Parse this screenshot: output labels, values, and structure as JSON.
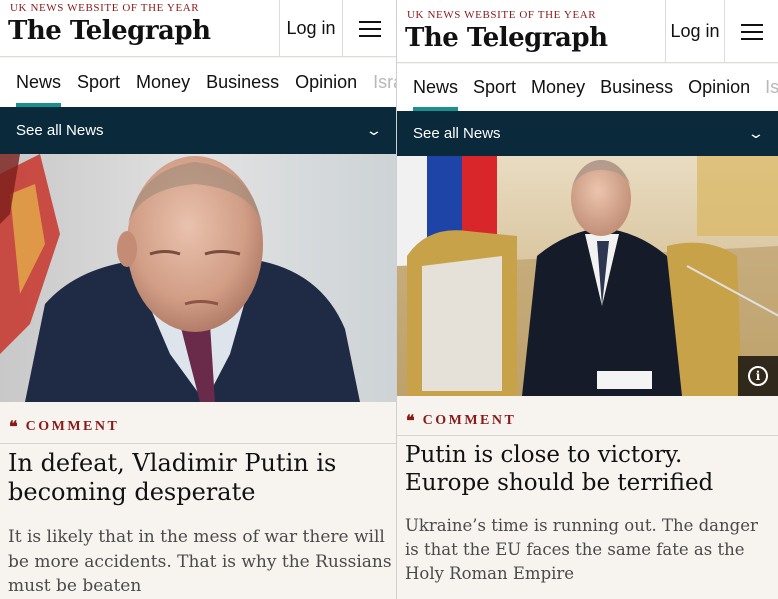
{
  "left": {
    "tagline": "UK NEWS WEBSITE OF THE YEAR",
    "logo": "The Telegraph",
    "login_label": "Log in",
    "menu_icon": "hamburger-menu-icon",
    "nav": [
      {
        "label": "News",
        "active": true
      },
      {
        "label": "Sport",
        "active": false
      },
      {
        "label": "Money",
        "active": false
      },
      {
        "label": "Business",
        "active": false
      },
      {
        "label": "Opinion",
        "active": false
      },
      {
        "label": "Isra",
        "active": false
      }
    ],
    "subnav_label": "See all News",
    "kicker": "COMMENT",
    "headline": "In defeat, Vladimir Putin is becoming desperate",
    "standfirst": "It is likely that in the mess of war there will be more accidents. That is why the Russians must be beaten"
  },
  "right": {
    "tagline": "UK NEWS WEBSITE OF THE YEAR",
    "logo": "The Telegraph",
    "login_label": "Log in",
    "menu_icon": "hamburger-menu-icon",
    "nav": [
      {
        "label": "News",
        "active": true
      },
      {
        "label": "Sport",
        "active": false
      },
      {
        "label": "Money",
        "active": false
      },
      {
        "label": "Business",
        "active": false
      },
      {
        "label": "Opinion",
        "active": false
      },
      {
        "label": "Isra",
        "active": false
      }
    ],
    "subnav_label": "See all News",
    "kicker": "COMMENT",
    "headline": "Putin is close to victory. Europe should be terrified",
    "standfirst": "Ukraine’s time is running out. The danger is that the EU faces the same fate as the Holy Roman Empire",
    "info_icon": "info-icon"
  },
  "colors": {
    "accent_teal": "#1b8f8a",
    "subnav_bg": "#0a2a3b",
    "kicker_red": "#8a1a1a",
    "page_bg": "#f7f4f0"
  }
}
